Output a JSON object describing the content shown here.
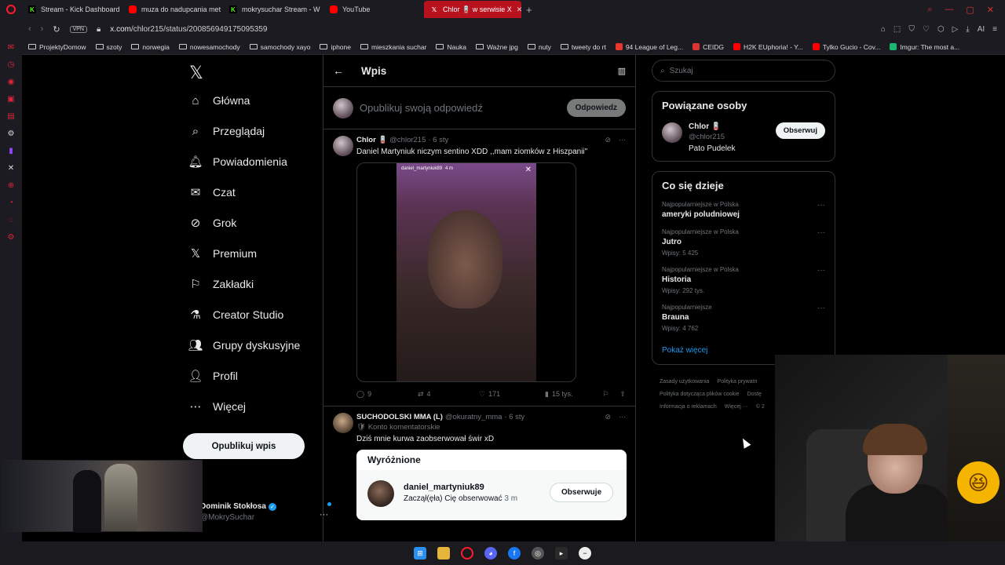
{
  "browser": {
    "tabs": [
      {
        "title": "Stream - Kick Dashboard",
        "icon": "kick-icon"
      },
      {
        "title": "muza do nadupcania met",
        "icon": "youtube-icon"
      },
      {
        "title": "mokrysuchar Stream - W",
        "icon": "kick-icon"
      },
      {
        "title": "YouTube",
        "icon": "youtube-icon"
      },
      {
        "title": "Chlor 🪫 w serwisie X",
        "icon": "x-icon",
        "active": true
      }
    ],
    "url_host": "x.com",
    "url_path": "/chlor215/status/2008569491750953​59",
    "vpn_label": "VPN",
    "ai_label": "AI",
    "bookmarks": [
      {
        "label": "ProjektyDomow",
        "type": "folder"
      },
      {
        "label": "szoty",
        "type": "folder"
      },
      {
        "label": "norwegia",
        "type": "folder"
      },
      {
        "label": "nowesamochody",
        "type": "folder"
      },
      {
        "label": "samochody xayo",
        "type": "folder"
      },
      {
        "label": "iphone",
        "type": "folder"
      },
      {
        "label": "mieszkania suchar",
        "type": "folder"
      },
      {
        "label": "Nauka",
        "type": "folder"
      },
      {
        "label": "Ważne jpg",
        "type": "folder"
      },
      {
        "label": "nuty",
        "type": "folder"
      },
      {
        "label": "tweety do rt",
        "type": "folder"
      },
      {
        "label": "94 League of Leg...",
        "type": "site",
        "color": "#e8372c"
      },
      {
        "label": "CEIDG",
        "type": "site",
        "color": "#d33"
      },
      {
        "label": "H2K EUphoria! - Y...",
        "type": "site",
        "color": "#ff0000"
      },
      {
        "label": "Tylko Gucio - Cov...",
        "type": "site",
        "color": "#ff0000"
      },
      {
        "label": "Imgur: The most a...",
        "type": "site",
        "color": "#1bb76e"
      }
    ]
  },
  "nav": {
    "items": [
      {
        "label": "Główna",
        "icon": "home-icon"
      },
      {
        "label": "Przeglądaj",
        "icon": "search-icon"
      },
      {
        "label": "Powiadomienia",
        "icon": "bell-icon"
      },
      {
        "label": "Czat",
        "icon": "mail-icon"
      },
      {
        "label": "Grok",
        "icon": "grok-icon"
      },
      {
        "label": "Premium",
        "icon": "x-icon"
      },
      {
        "label": "Zakładki",
        "icon": "bookmark-icon"
      },
      {
        "label": "Creator Studio",
        "icon": "flask-icon"
      },
      {
        "label": "Grupy dyskusyjne",
        "icon": "people-icon"
      },
      {
        "label": "Profil",
        "icon": "person-icon"
      },
      {
        "label": "Więcej",
        "icon": "more-icon"
      }
    ],
    "post_button": "Opublikuj wpis",
    "me_name": "Dominik Stokłosa",
    "me_handle": "@MokrySuchar"
  },
  "center": {
    "title": "Wpis",
    "reply_placeholder": "Opublikuj swoją odpowiedź",
    "reply_button": "Odpowiedz",
    "tweet1": {
      "name": "Chlor 🪫",
      "handle": "@chlor215",
      "time": "· 6 sty",
      "text": "Daniel Martyniuk niczym sentino XDD ,,mam ziomków z Hiszpanii\"",
      "video_user": "daniel_martyniuk89",
      "video_time": "4 m",
      "replies": "9",
      "reposts": "4",
      "likes": "171",
      "views": "15 tys."
    },
    "tweet2": {
      "name": "SUCHODOLSKI MMA (L)",
      "handle": "@okuratny_mma",
      "time": "· 6 sty",
      "badge": "Konto komentatorskie",
      "text": "Dziś mnie kurwa zaobserwował świr xD",
      "featured_title": "Wyróżnione",
      "featured_user": "daniel_martyniuk89",
      "featured_sub": "Zaczął(ęła) Cię obserwować",
      "featured_time": "3 m",
      "featured_button": "Obserwuje"
    }
  },
  "right": {
    "search_placeholder": "Szukaj",
    "related_title": "Powiązane osoby",
    "related": {
      "name": "Chlor 🪫",
      "handle": "@chlor215",
      "bio": "Pato Pudelek",
      "button": "Obserwuj"
    },
    "trends_title": "Co się dzieje",
    "trends": [
      {
        "context": "Najpopularniejsze w Polska",
        "topic": "ameryki poludniowej",
        "count": ""
      },
      {
        "context": "Najpopularniejsze w Polska",
        "topic": "Jutro",
        "count": "Wpisy: 5 425"
      },
      {
        "context": "Najpopularniejsze w Polska",
        "topic": "Historia",
        "count": "Wpisy: 292 tys."
      },
      {
        "context": "Najpopularniejsze",
        "topic": "Brauna",
        "count": "Wpisy: 4 762"
      }
    ],
    "show_more": "Pokaż więcej",
    "footer": [
      "Zasady użytkowania",
      "Polityka prywatn",
      "Polityka dotycząca plików cookie",
      "Dostę",
      "Informacja o reklamach",
      "Więcej ···",
      "© 2"
    ]
  }
}
